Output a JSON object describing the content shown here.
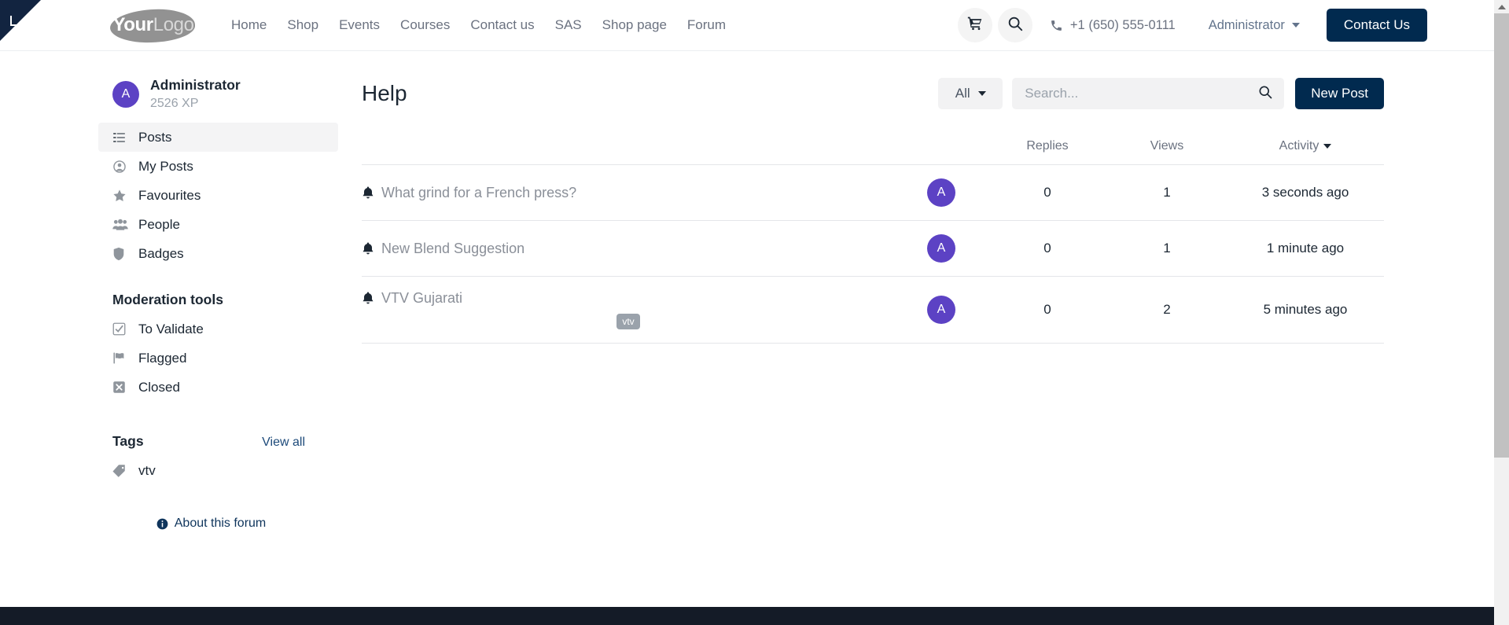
{
  "header": {
    "logo": {
      "bold": "Your",
      "light": "Logo"
    },
    "nav": [
      {
        "label": "Home"
      },
      {
        "label": "Shop"
      },
      {
        "label": "Events"
      },
      {
        "label": "Courses"
      },
      {
        "label": "Contact us"
      },
      {
        "label": "SAS"
      },
      {
        "label": "Shop page"
      },
      {
        "label": "Forum"
      }
    ],
    "cart_icon": "shopping-cart-icon",
    "search_icon": "search-icon",
    "phone": "+1 (650) 555-0111",
    "user_menu": "Administrator",
    "contact_button": "Contact Us",
    "accent_navy": "#012a4f"
  },
  "sidebar": {
    "user": {
      "initial": "A",
      "name": "Administrator",
      "xp": "2526 XP",
      "avatar_color": "#5c42c4"
    },
    "items": [
      {
        "label": "Posts",
        "icon": "list-icon",
        "active": true
      },
      {
        "label": "My Posts",
        "icon": "user-circle-icon",
        "active": false
      },
      {
        "label": "Favourites",
        "icon": "star-icon",
        "active": false
      },
      {
        "label": "People",
        "icon": "users-icon",
        "active": false
      },
      {
        "label": "Badges",
        "icon": "shield-icon",
        "active": false
      }
    ],
    "moderation_heading": "Moderation tools",
    "moderation_items": [
      {
        "label": "To Validate",
        "icon": "check-square-icon"
      },
      {
        "label": "Flagged",
        "icon": "flag-icon"
      },
      {
        "label": "Closed",
        "icon": "close-square-icon"
      }
    ],
    "tags_heading": "Tags",
    "tags_view_all": "View all",
    "tags": [
      {
        "label": "vtv",
        "icon": "tag-icon"
      }
    ],
    "about_link": "About this forum"
  },
  "main": {
    "title": "Help",
    "filter_label": "All",
    "search_placeholder": "Search...",
    "search_value": "",
    "new_post_label": "New Post",
    "columns": {
      "title": "",
      "author": "",
      "replies": "Replies",
      "views": "Views",
      "activity": "Activity"
    },
    "posts": [
      {
        "icon": "bell-icon",
        "title": "What grind for a French press?",
        "tags": [],
        "author_initial": "A",
        "replies": "0",
        "views": "1",
        "activity": "3 seconds ago"
      },
      {
        "icon": "bell-icon",
        "title": "New Blend Suggestion",
        "tags": [],
        "author_initial": "A",
        "replies": "0",
        "views": "1",
        "activity": "1 minute ago"
      },
      {
        "icon": "bell-icon",
        "title": "VTV Gujarati",
        "tags": [
          "vtv"
        ],
        "author_initial": "A",
        "replies": "0",
        "views": "2",
        "activity": "5 minutes ago"
      }
    ]
  }
}
